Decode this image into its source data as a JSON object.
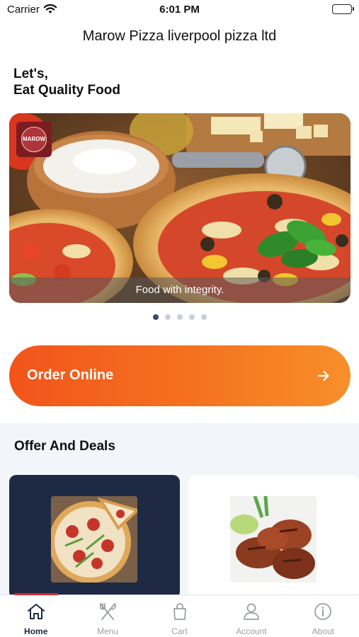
{
  "status_bar": {
    "carrier": "Carrier",
    "time": "6:01 PM",
    "wifi_icon": "wifi-icon",
    "battery_icon": "battery-icon"
  },
  "header": {
    "title": "Marow Pizza liverpool pizza ltd"
  },
  "greeting": {
    "line1": "Let's,",
    "line2": "Eat Quality Food"
  },
  "hero": {
    "caption": "Food with integrity.",
    "logo_text": "MAROW",
    "slide_count": 5,
    "active_slide": 1
  },
  "order": {
    "label": "Order Online",
    "icon": "arrow-right-icon"
  },
  "deals": {
    "title": "Offer And Deals",
    "cards": [
      {
        "image": "pizza-image"
      },
      {
        "image": "grilled-chicken-image"
      }
    ]
  },
  "tabs": [
    {
      "label": "Home",
      "icon": "home-icon",
      "active": true
    },
    {
      "label": "Menu",
      "icon": "fork-knife-icon",
      "active": false
    },
    {
      "label": "Cart",
      "icon": "shopping-bag-icon",
      "active": false
    },
    {
      "label": "Account",
      "icon": "user-icon",
      "active": false
    },
    {
      "label": "About",
      "icon": "info-icon",
      "active": false
    }
  ],
  "colors": {
    "accent_orange": "#f2541b",
    "navy": "#1e2a44",
    "deal_highlight_red": "#e0262e"
  }
}
